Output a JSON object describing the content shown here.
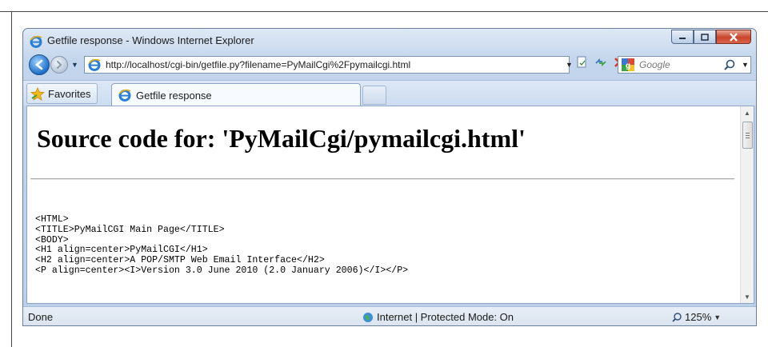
{
  "window": {
    "title": "Getfile response - Windows Internet Explorer",
    "minimize_icon": "minimize-icon",
    "maximize_icon": "maximize-icon",
    "close_icon": "close-icon"
  },
  "nav": {
    "address": "http://localhost/cgi-bin/getfile.py?filename=PyMailCgi%2Fpymailcgi.html",
    "search_placeholder": "Google"
  },
  "tabs": {
    "favorites_label": "Favorites",
    "active_tab_label": "Getfile response"
  },
  "page": {
    "heading": "Source code for: 'PyMailCgi/pymailcgi.html'",
    "code_lines": [
      "<HTML>",
      "<TITLE>PyMailCGI Main Page</TITLE>",
      "<BODY>",
      "<H1 align=center>PyMailCGI</H1>",
      "<H2 align=center>A POP/SMTP Web Email Interface</H2>",
      "<P align=center><I>Version 3.0 June 2010 (2.0 January 2006)</I></P>"
    ]
  },
  "status": {
    "text": "Done",
    "zone": "Internet | Protected Mode: On",
    "zoom": "125%"
  },
  "colors": {
    "chrome": "#c3d5ec",
    "close_button": "#c8442c",
    "accent": "#1f6fc9"
  }
}
